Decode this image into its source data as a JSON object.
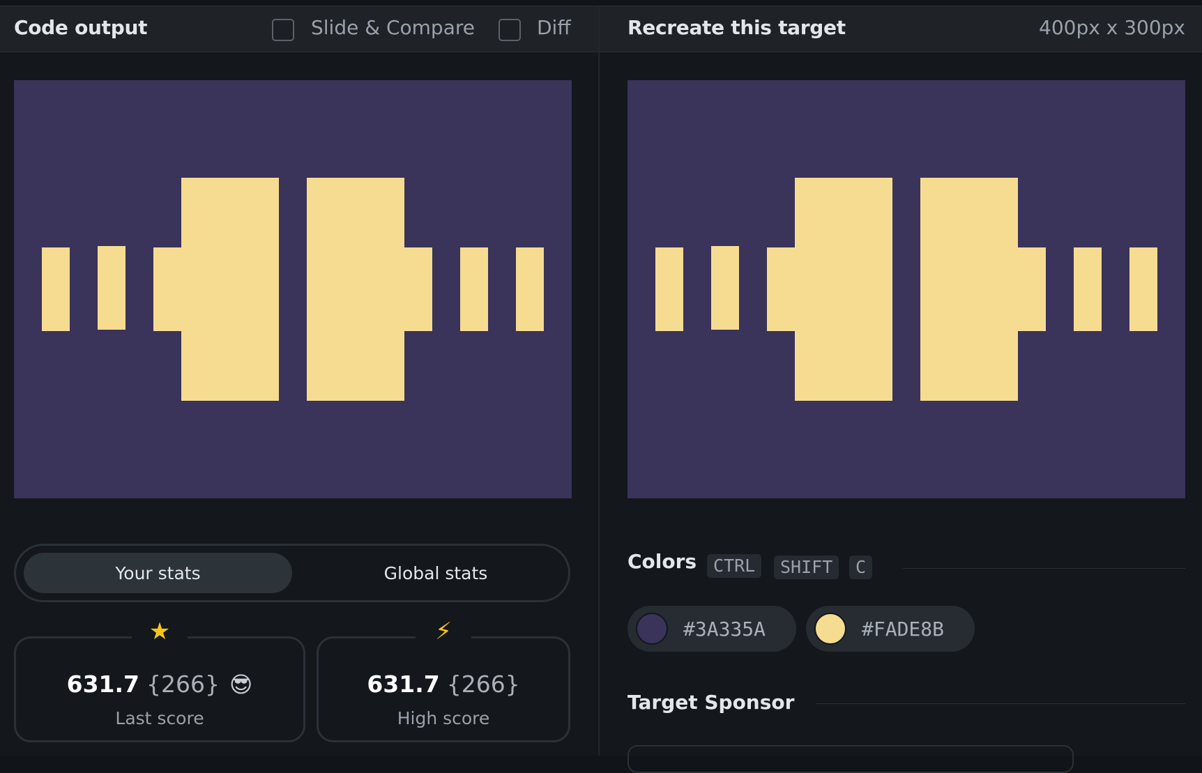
{
  "left_panel": {
    "title": "Code output",
    "slide_compare_label": "Slide & Compare",
    "diff_label": "Diff"
  },
  "right_panel": {
    "title": "Recreate this target",
    "dimensions": "400px x 300px"
  },
  "colors": {
    "background": "#3A335A",
    "foreground": "#FADE8B"
  },
  "stats_toggle": {
    "your_stats": "Your stats",
    "global_stats": "Global stats"
  },
  "stats": {
    "last": {
      "icon": "star-icon",
      "score": "631.7",
      "chars": "{266}",
      "emoji": "😎",
      "label": "Last score"
    },
    "high": {
      "icon": "lightning-icon",
      "score": "631.7",
      "chars": "{266}",
      "label": "High score"
    }
  },
  "colors_section": {
    "title": "Colors",
    "shortcut": [
      "CTRL",
      "SHIFT",
      "C"
    ],
    "swatches": [
      {
        "hex": "#3A335A"
      },
      {
        "hex": "#FADE8B"
      }
    ]
  },
  "sponsor_section": {
    "title": "Target Sponsor"
  }
}
